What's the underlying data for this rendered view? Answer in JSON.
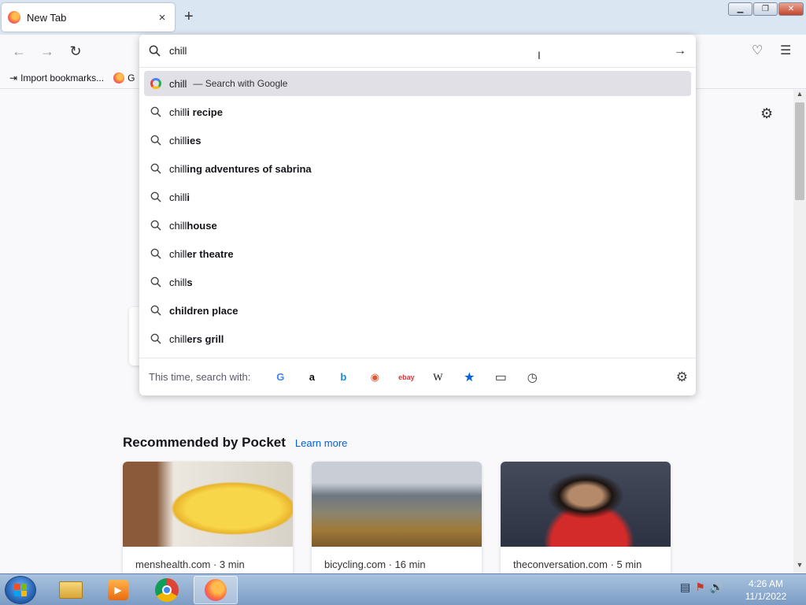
{
  "browser": {
    "tab_title": "New Tab",
    "tab_close": "×",
    "new_tab": "+",
    "bookmarks": [
      {
        "label": "Import bookmarks...",
        "icon": "import-icon"
      },
      {
        "label": "G",
        "icon": "firefox-icon"
      }
    ]
  },
  "urlbar": {
    "value": "chill",
    "go_icon": "arrow-right-icon"
  },
  "suggestions": [
    {
      "typed": "chill",
      "completion": "",
      "action": "— Search with Google",
      "icon": "google-icon"
    },
    {
      "typed": "chill",
      "completion": "i recipe",
      "icon": "search-icon"
    },
    {
      "typed": "chill",
      "completion": "ies",
      "icon": "search-icon"
    },
    {
      "typed": "chill",
      "completion": "ing adventures of sabrina",
      "icon": "search-icon"
    },
    {
      "typed": "chill",
      "completion": "i",
      "icon": "search-icon"
    },
    {
      "typed": "chill",
      "completion": "house",
      "icon": "search-icon"
    },
    {
      "typed": "chill",
      "completion": "er theatre",
      "icon": "search-icon"
    },
    {
      "typed": "chill",
      "completion": "s",
      "icon": "search-icon"
    },
    {
      "typed": "",
      "completion": "children place",
      "icon": "search-icon"
    },
    {
      "typed": "chill",
      "completion": "ers grill",
      "icon": "search-icon"
    }
  ],
  "one_off": {
    "label": "This time, search with:",
    "engines": [
      {
        "name": "google",
        "glyph": "G",
        "color": "#4285f4"
      },
      {
        "name": "amazon",
        "glyph": "a",
        "color": "#111111"
      },
      {
        "name": "bing",
        "glyph": "b",
        "color": "#1a8cd8"
      },
      {
        "name": "duckduckgo",
        "glyph": "◉",
        "color": "#de5833"
      },
      {
        "name": "ebay",
        "glyph": "ebay",
        "color": "#e53238"
      },
      {
        "name": "wikipedia",
        "glyph": "W",
        "color": "#111111"
      },
      {
        "name": "bookmarks",
        "glyph": "★",
        "color": "#0061e0"
      },
      {
        "name": "tabs",
        "glyph": "▭",
        "color": "#333333"
      },
      {
        "name": "history",
        "glyph": "◷",
        "color": "#333333"
      }
    ]
  },
  "pocket": {
    "heading": "Recommended by Pocket",
    "learn_more": "Learn more",
    "cards": [
      {
        "source": "menshealth.com · 3 min",
        "image": "scrambled-eggs"
      },
      {
        "source": "bicycling.com · 16 min",
        "image": "mountain-road"
      },
      {
        "source": "theconversation.com · 5 min",
        "image": "portrait"
      }
    ]
  },
  "clock": {
    "time": "4:26 AM",
    "date": "11/1/2022"
  }
}
